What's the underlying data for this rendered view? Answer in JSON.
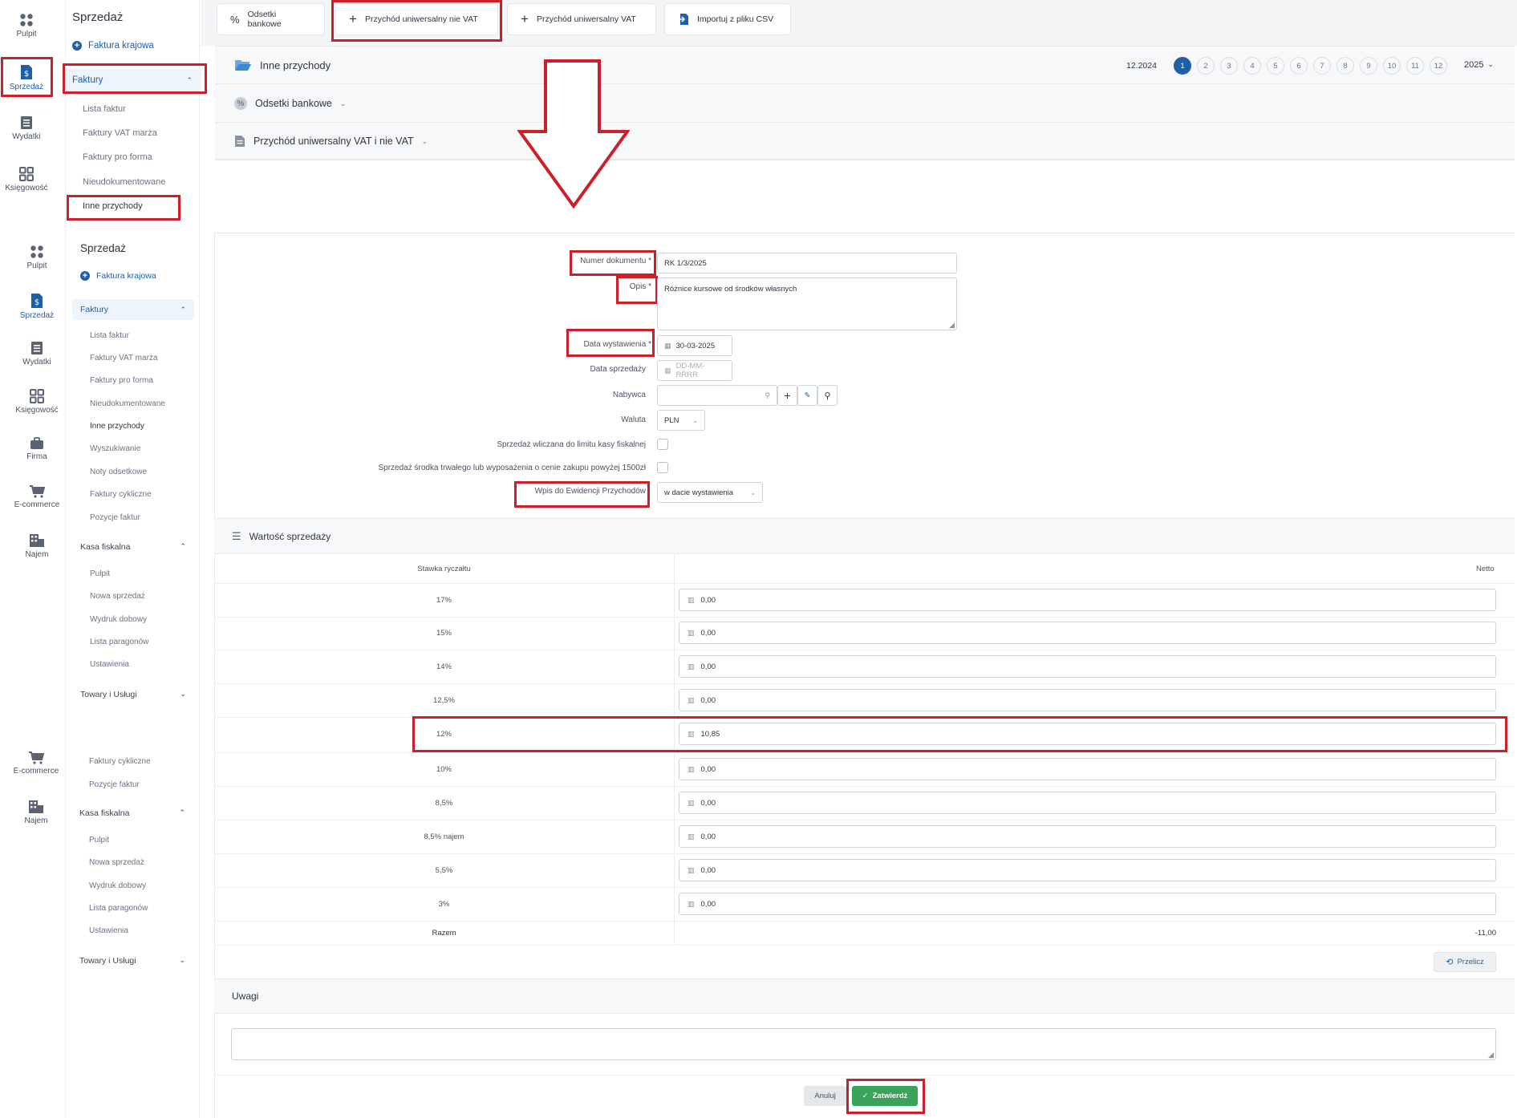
{
  "rail_top": [
    {
      "label": "Pulpit",
      "icon": "grid-dots-icon"
    },
    {
      "label": "Sprzedaż",
      "icon": "invoice-dollar-icon"
    },
    {
      "label": "Wydatki",
      "icon": "receipt-icon"
    },
    {
      "label": "Księgowość",
      "icon": "apps-icon"
    }
  ],
  "rail_mid": [
    {
      "label": "Pulpit"
    },
    {
      "label": "Sprzedaż"
    },
    {
      "label": "Wydatki"
    },
    {
      "label": "Księgowość"
    },
    {
      "label": "Firma"
    },
    {
      "label": "E-commerce"
    },
    {
      "label": "Najem"
    }
  ],
  "rail_bottom": [
    {
      "label": "E-commerce"
    },
    {
      "label": "Najem"
    }
  ],
  "nav1": {
    "title": "Sprzedaż",
    "add": "Faktura krajowa",
    "group": "Faktury",
    "items": [
      "Lista faktur",
      "Faktury VAT marża",
      "Faktury pro forma",
      "Nieudokumentowane",
      "Inne przychody"
    ]
  },
  "nav2": {
    "title": "Sprzedaż",
    "add": "Faktura krajowa",
    "group": "Faktury",
    "items": [
      "Lista faktur",
      "Faktury VAT marża",
      "Faktury pro forma",
      "Nieudokumentowane",
      "Inne przychody",
      "Wyszukiwanie",
      "Noty odsetkowe",
      "Faktury cykliczne",
      "Pozycje faktur"
    ],
    "kasa": "Kasa fiskalna",
    "kasa_items": [
      "Pulpit",
      "Nowa sprzedaż",
      "Wydruk dobowy",
      "Lista paragonów",
      "Ustawienia"
    ],
    "towary": "Towary i Usługi"
  },
  "nav3": {
    "items": [
      "Faktury cykliczne",
      "Pozycje faktur"
    ],
    "kasa": "Kasa fiskalna",
    "kasa_items": [
      "Pulpit",
      "Nowa sprzedaż",
      "Wydruk dobowy",
      "Lista paragonów",
      "Ustawienia"
    ],
    "towary": "Towary i Usługi"
  },
  "toolbar": {
    "odsetki": "Odsetki bankowe",
    "nie_vat": "Przychód uniwersalny nie VAT",
    "vat": "Przychód uniwersalny VAT",
    "csv": "Importuj z pliku CSV"
  },
  "sections": {
    "inne": "Inne przychody",
    "odsetki": "Odsetki bankowe",
    "uniwersalny": "Przychód uniwersalny VAT i nie VAT",
    "period_label": "12.2024",
    "months": [
      "1",
      "2",
      "3",
      "4",
      "5",
      "6",
      "7",
      "8",
      "9",
      "10",
      "11",
      "12"
    ],
    "active_month": "1",
    "year": "2025"
  },
  "form": {
    "numer_label": "Numer dokumentu *",
    "numer_value": "RK 1/3/2025",
    "opis_label": "Opis *",
    "opis_value": "Różnice kursowe od środków własnych",
    "data_wyst_label": "Data wystawienia *",
    "data_wyst_value": "30-03-2025",
    "data_sprz_label": "Data sprzedaży",
    "data_sprz_placeholder": "DD-MM-RRRR",
    "nabywca_label": "Nabywca",
    "waluta_label": "Waluta",
    "waluta_value": "PLN",
    "limit_label": "Sprzedaż wliczana do limitu kasy fiskalnej",
    "srodek_label": "Sprzedaż środka trwałego lub wyposażenia o cenie zakupu powyżej 1500zł",
    "wpis_label": "Wpis do Ewidencji Przychodów",
    "wpis_value": "w dacie wystawienia"
  },
  "table": {
    "title": "Wartość sprzedaży",
    "col_rate": "Stawka ryczałtu",
    "col_netto": "Netto",
    "rows": [
      {
        "rate": "17%",
        "netto": "0,00"
      },
      {
        "rate": "15%",
        "netto": "0,00"
      },
      {
        "rate": "14%",
        "netto": "0,00"
      },
      {
        "rate": "12,5%",
        "netto": "0,00"
      },
      {
        "rate": "12%",
        "netto": "10,85"
      },
      {
        "rate": "10%",
        "netto": "0,00"
      },
      {
        "rate": "8,5%",
        "netto": "0,00"
      },
      {
        "rate": "8,5% najem",
        "netto": "0,00"
      },
      {
        "rate": "5,5%",
        "netto": "0,00"
      },
      {
        "rate": "3%",
        "netto": "0,00"
      }
    ],
    "razem_label": "Razem",
    "razem_value": "-11,00",
    "przelicz": "Przelicz"
  },
  "uwagi": {
    "title": "Uwagi"
  },
  "actions": {
    "anuluj": "Anuluj",
    "zatwierdz": "Zatwierdź"
  },
  "colors": {
    "accent": "#1f5fa8",
    "highlight": "#cc1f2a",
    "confirm": "#3aa35b"
  }
}
